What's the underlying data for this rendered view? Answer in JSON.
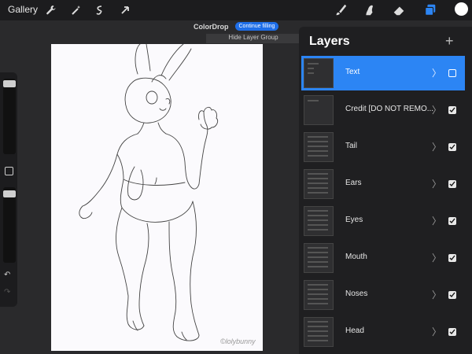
{
  "topbar": {
    "gallery_label": "Gallery",
    "left_tools": [
      "wrench-icon",
      "magic-wand-icon",
      "selection-icon",
      "transform-icon"
    ],
    "right_tools": [
      "brush-icon",
      "smudge-icon",
      "eraser-icon",
      "layers-icon"
    ],
    "active_tool_color": "#2c85f4",
    "color_swatch": "#ffffff"
  },
  "colordrop": {
    "title": "ColorDrop",
    "button_label": "Continue filling"
  },
  "layer_group": {
    "hide_label": "Hide Layer Group"
  },
  "sidebar": {
    "undo_icon": "↶",
    "redo_icon": "↷"
  },
  "canvas": {
    "watermark": "©lolybunny"
  },
  "layers_panel": {
    "title": "Layers",
    "add_icon": "+",
    "items": [
      {
        "name": "Text",
        "active": true,
        "visible": false
      },
      {
        "name": "Credit [DO NOT REMO...",
        "active": false,
        "visible": true
      },
      {
        "name": "Tail",
        "active": false,
        "visible": true
      },
      {
        "name": "Ears",
        "active": false,
        "visible": true
      },
      {
        "name": "Eyes",
        "active": false,
        "visible": true
      },
      {
        "name": "Mouth",
        "active": false,
        "visible": true
      },
      {
        "name": "Noses",
        "active": false,
        "visible": true
      },
      {
        "name": "Head",
        "active": false,
        "visible": true
      }
    ]
  }
}
